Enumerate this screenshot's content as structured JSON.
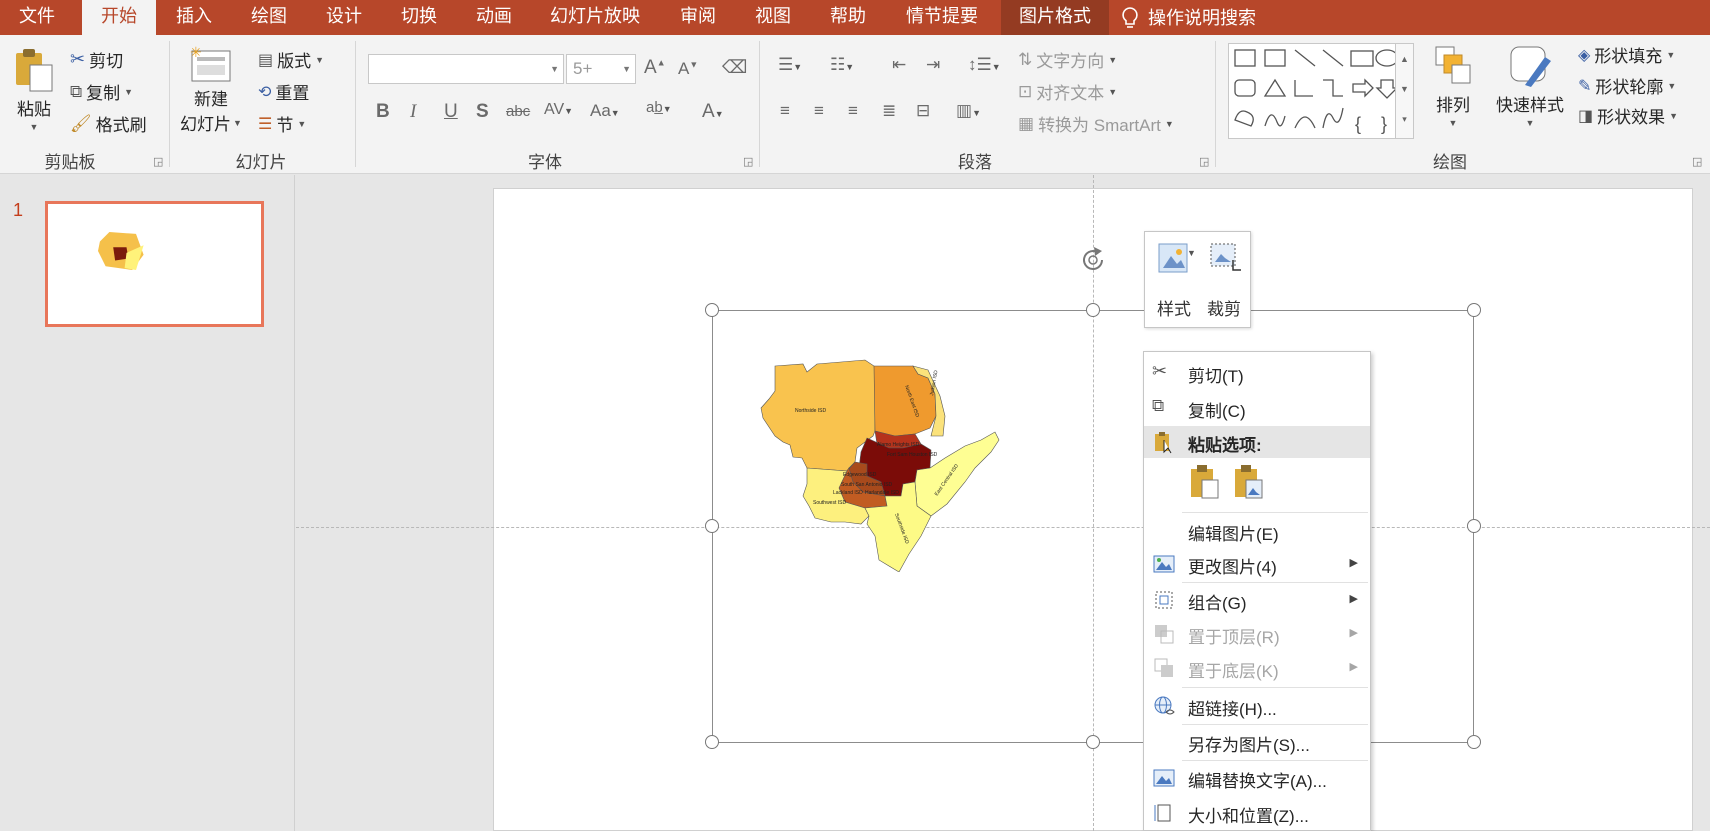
{
  "tabs": [
    {
      "label": "文件",
      "state": "normal"
    },
    {
      "label": "开始",
      "state": "active"
    },
    {
      "label": "插入",
      "state": "normal"
    },
    {
      "label": "绘图",
      "state": "normal"
    },
    {
      "label": "设计",
      "state": "normal"
    },
    {
      "label": "切换",
      "state": "normal"
    },
    {
      "label": "动画",
      "state": "normal"
    },
    {
      "label": "幻灯片放映",
      "state": "normal"
    },
    {
      "label": "审阅",
      "state": "normal"
    },
    {
      "label": "视图",
      "state": "normal"
    },
    {
      "label": "帮助",
      "state": "normal"
    },
    {
      "label": "情节提要",
      "state": "normal"
    },
    {
      "label": "图片格式",
      "state": "context"
    }
  ],
  "tell_me": "操作说明搜索",
  "colors": {
    "accent": "#b7472a",
    "context_tab": "#943b22",
    "ribbon_bg": "#f3f3f3",
    "thumb_border": "#e8765a"
  },
  "clipboard": {
    "paste": "粘贴",
    "cut": "剪切",
    "copy": "复制",
    "format_painter": "格式刷",
    "label": "剪贴板"
  },
  "slides_group": {
    "new_slide_line1": "新建",
    "new_slide_line2": "幻灯片",
    "layout": "版式",
    "reset": "重置",
    "section": "节",
    "label": "幻灯片"
  },
  "font_group": {
    "font_name": "",
    "font_size": "5+",
    "label": "字体"
  },
  "paragraph_group": {
    "text_direction": "文字方向",
    "align_text": "对齐文本",
    "convert_smartart": "转换为 SmartArt",
    "label": "段落"
  },
  "drawing_group": {
    "arrange": "排列",
    "quick_styles": "快速样式",
    "shape_fill": "形状填充",
    "shape_outline": "形状轮廓",
    "shape_effects": "形状效果",
    "label": "绘图"
  },
  "slide_panel": {
    "slide_number": "1"
  },
  "map_labels": [
    "Northside ISD",
    "North East ISD",
    "Alamo Heights ISD",
    "Fort Sam Houston ISD",
    "Judson ISD",
    "Edgewood ISD",
    "South San Antonio ISD",
    "Lackland ISD",
    "Harlandale ISD",
    "Southwest ISD",
    "Southside ISD",
    "East Central ISD"
  ],
  "mini_toolbar": {
    "style": "样式",
    "crop": "裁剪"
  },
  "context_menu": {
    "cut": "剪切(T)",
    "copy": "复制(C)",
    "paste_options": "粘贴选项:",
    "edit_picture": "编辑图片(E)",
    "change_picture": "更改图片(4)",
    "group": "组合(G)",
    "bring_to_front": "置于顶层(R)",
    "send_to_back": "置于底层(K)",
    "hyperlink": "超链接(H)...",
    "save_as_picture": "另存为图片(S)...",
    "edit_alt_text": "编辑替换文字(A)...",
    "size_position": "大小和位置(Z)..."
  }
}
